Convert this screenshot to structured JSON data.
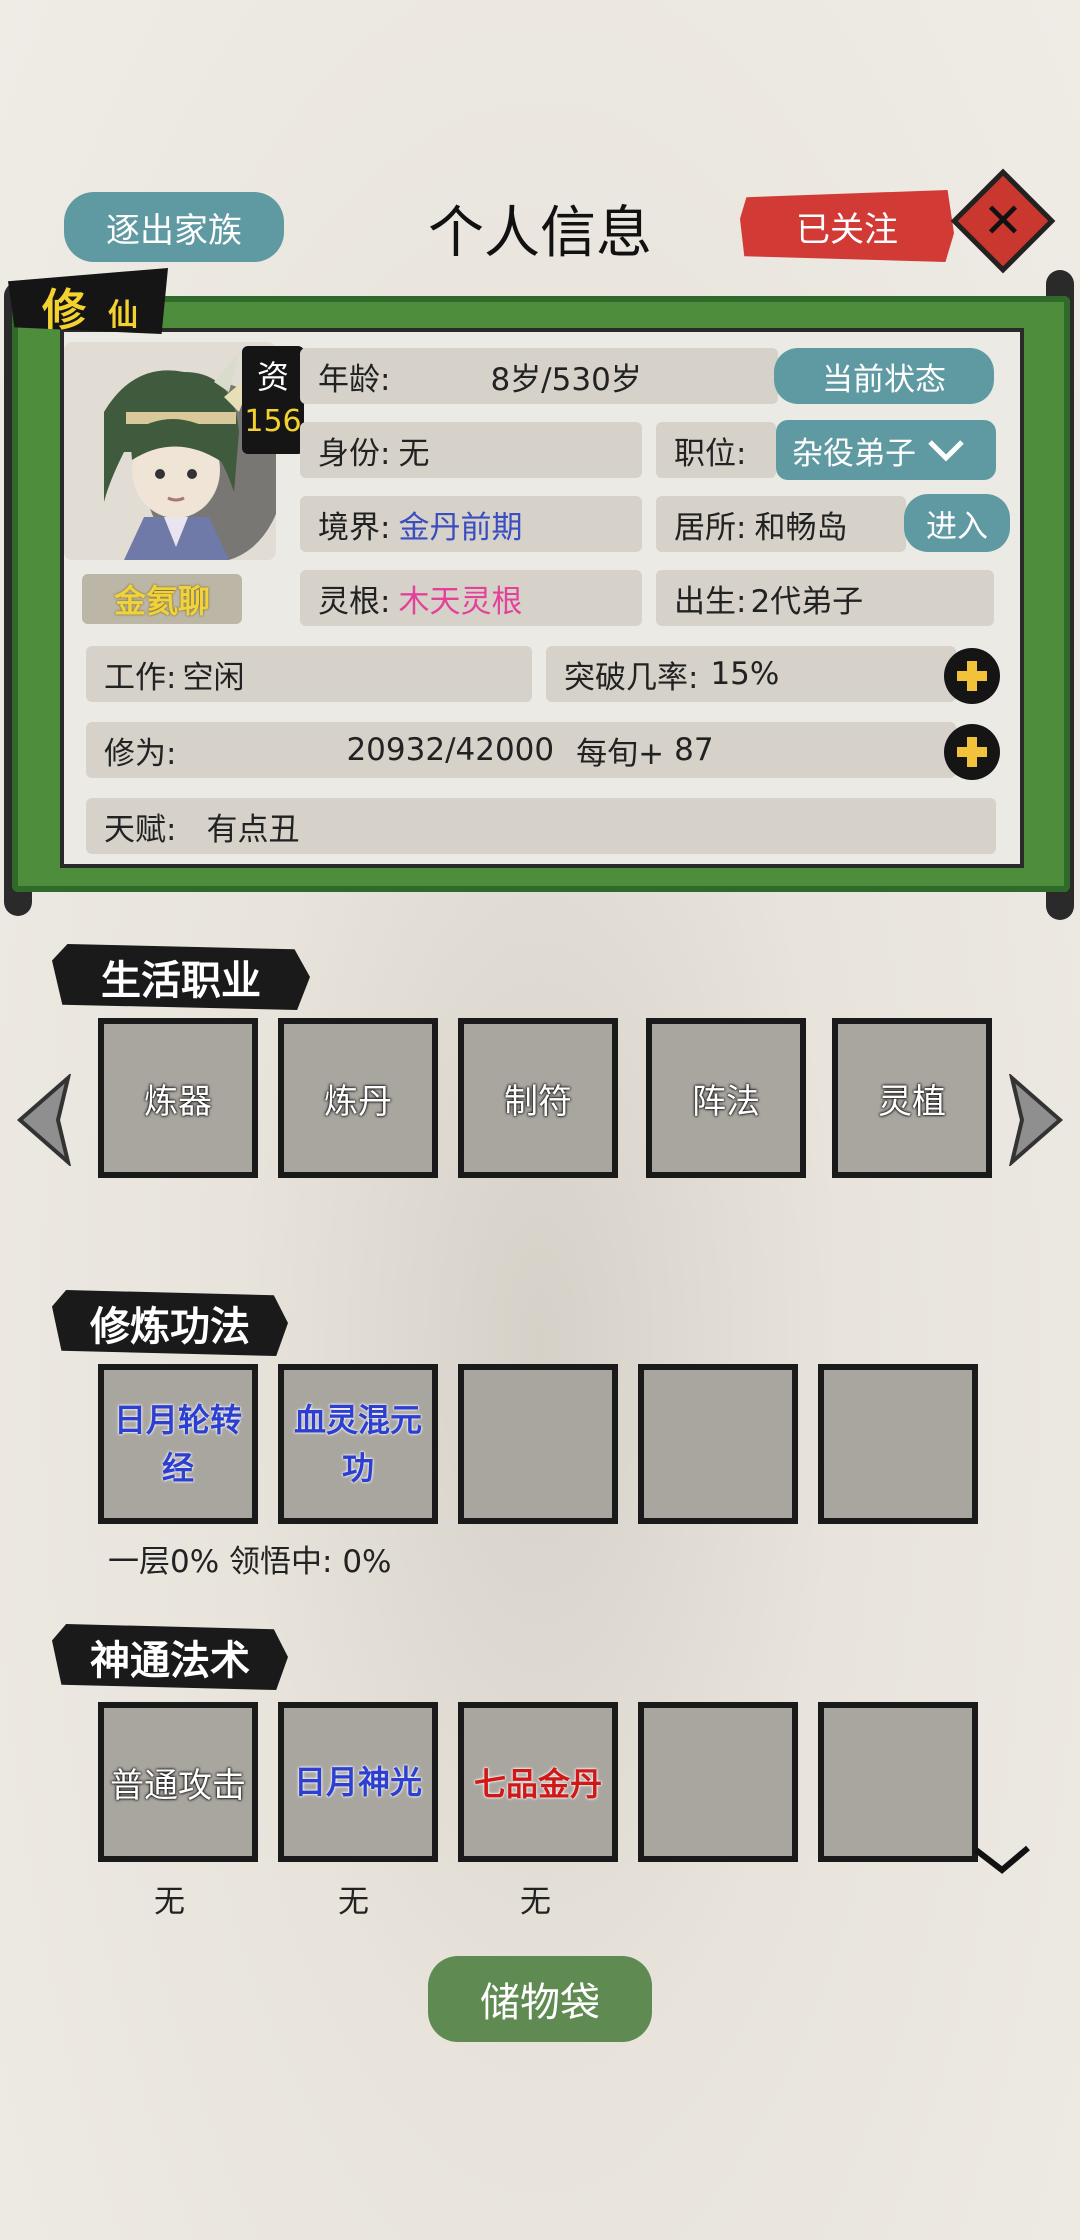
{
  "header": {
    "title": "个人信息",
    "expel_label": "逐出家族",
    "followed_label": "已关注",
    "close_symbol": "✕"
  },
  "profile": {
    "tag_big": "修",
    "tag_small": "仙",
    "aptitude_label": "资",
    "aptitude_value": "156",
    "name": "金氦聊",
    "age_label": "年龄:",
    "age_value": "8岁/530岁",
    "status_button": "当前状态",
    "identity_label": "身份:",
    "identity_value": "无",
    "position_label": "职位:",
    "position_value": "杂役弟子",
    "realm_label": "境界:",
    "realm_value": "金丹前期",
    "residence_label": "居所:",
    "residence_value": "和畅岛",
    "enter_button": "进入",
    "root_label": "灵根:",
    "root_value": "木天灵根",
    "birth_label": "出生:",
    "birth_value": "2代弟子",
    "work_label": "工作:",
    "work_value": "空闲",
    "breakthrough_label": "突破几率:",
    "breakthrough_value": "15%",
    "cultivation_label": "修为:",
    "cultivation_value": "20932/42000",
    "per_period_label": "每旬+",
    "per_period_value": "87",
    "talent_label": "天赋:",
    "talent_value": "有点丑"
  },
  "life_jobs": {
    "title": "生活职业",
    "items": [
      "炼器",
      "炼丹",
      "制符",
      "阵法",
      "灵植"
    ]
  },
  "techniques": {
    "title": "修炼功法",
    "items": [
      "日月轮转经",
      "血灵混元功",
      "",
      "",
      ""
    ],
    "progress_text": "一层0% 领悟中: 0%"
  },
  "spells": {
    "title": "神通法术",
    "items": [
      "普通攻击",
      "日月神光",
      "七品金丹",
      "",
      ""
    ],
    "sub_labels": [
      "无",
      "无",
      "无"
    ]
  },
  "bag_button": "储物袋",
  "colors": {
    "teal": "#5f9aa3",
    "red": "#d23a36",
    "scroll_green": "#4d8d3c",
    "gold": "#f3d230",
    "blue_text": "#3a4ec0",
    "pink_text": "#e4429a"
  }
}
